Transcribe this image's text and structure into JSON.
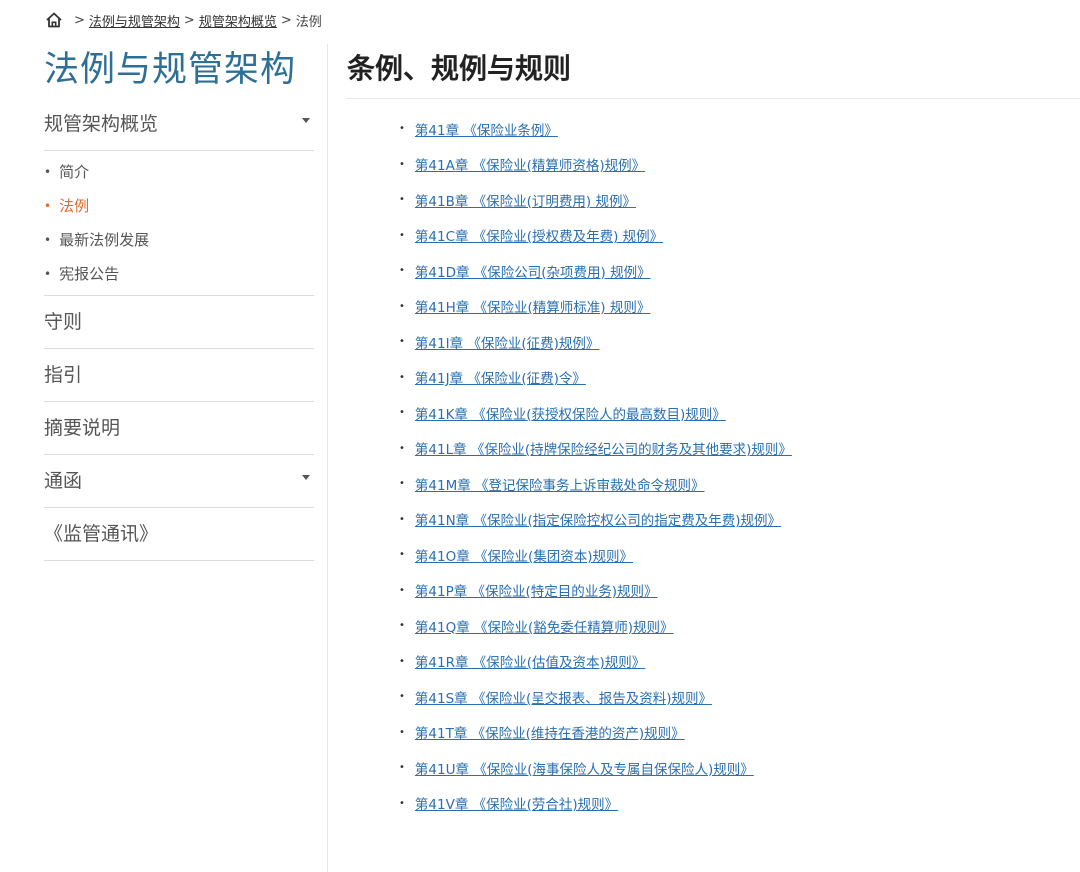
{
  "breadcrumb": {
    "items": [
      "法例与规管架构",
      "规管架构概览"
    ],
    "current": "法例",
    "separator": ">"
  },
  "sidebar": {
    "title": "法例与规管架构",
    "sections": [
      {
        "label": "规管架构概览",
        "expandable": true,
        "items": [
          {
            "label": "简介",
            "active": false
          },
          {
            "label": "法例",
            "active": true
          },
          {
            "label": "最新法例发展",
            "active": false
          },
          {
            "label": "宪报公告",
            "active": false
          }
        ]
      },
      {
        "label": "守则",
        "expandable": false
      },
      {
        "label": "指引",
        "expandable": false
      },
      {
        "label": "摘要说明",
        "expandable": false
      },
      {
        "label": "通函",
        "expandable": true
      },
      {
        "label": "《监管通讯》",
        "expandable": false
      }
    ]
  },
  "main": {
    "title": "条例、规例与规则",
    "regulations": [
      "第41章 《保险业条例》",
      "第41A章 《保险业(精算师资格)规例》",
      "第41B章 《保险业(订明费用) 规例》",
      "第41C章 《保险业(授权费及年费) 规例》",
      "第41D章 《保险公司(杂项费用) 规例》",
      "第41H章 《保险业(精算师标准) 规则》",
      "第41I章 《保险业(征费)规例》",
      "第41J章 《保险业(征费)令》",
      "第41K章 《保险业(获授权保险人的最高数目)规则》",
      "第41L章 《保险业(持牌保险经纪公司的财务及其他要求)规则》",
      "第41M章 《登记保险事务上诉审裁处命令规则》",
      "第41N章 《保险业(指定保险控权公司的指定费及年费)规例》",
      "第41O章 《保险业(集团资本)规则》",
      "第41P章 《保险业(特定目的业务)规则》",
      "第41Q章 《保险业(豁免委任精算师)规则》",
      "第41R章 《保险业(估值及资本)规则》",
      "第41S章 《保险业(呈交报表、报告及资料)规则》",
      "第41T章 《保险业(维持在香港的资产)规则》",
      "第41U章 《保险业(海事保险人及专属自保保险人)规则》",
      "第41V章 《保险业(劳合社)规则》"
    ]
  },
  "colors": {
    "sidebar_title": "#2e6f96",
    "active_item": "#e06a2b",
    "link": "#2a6fb0"
  },
  "icons": {
    "home": "home-icon",
    "caret": "chevron-down-icon"
  }
}
